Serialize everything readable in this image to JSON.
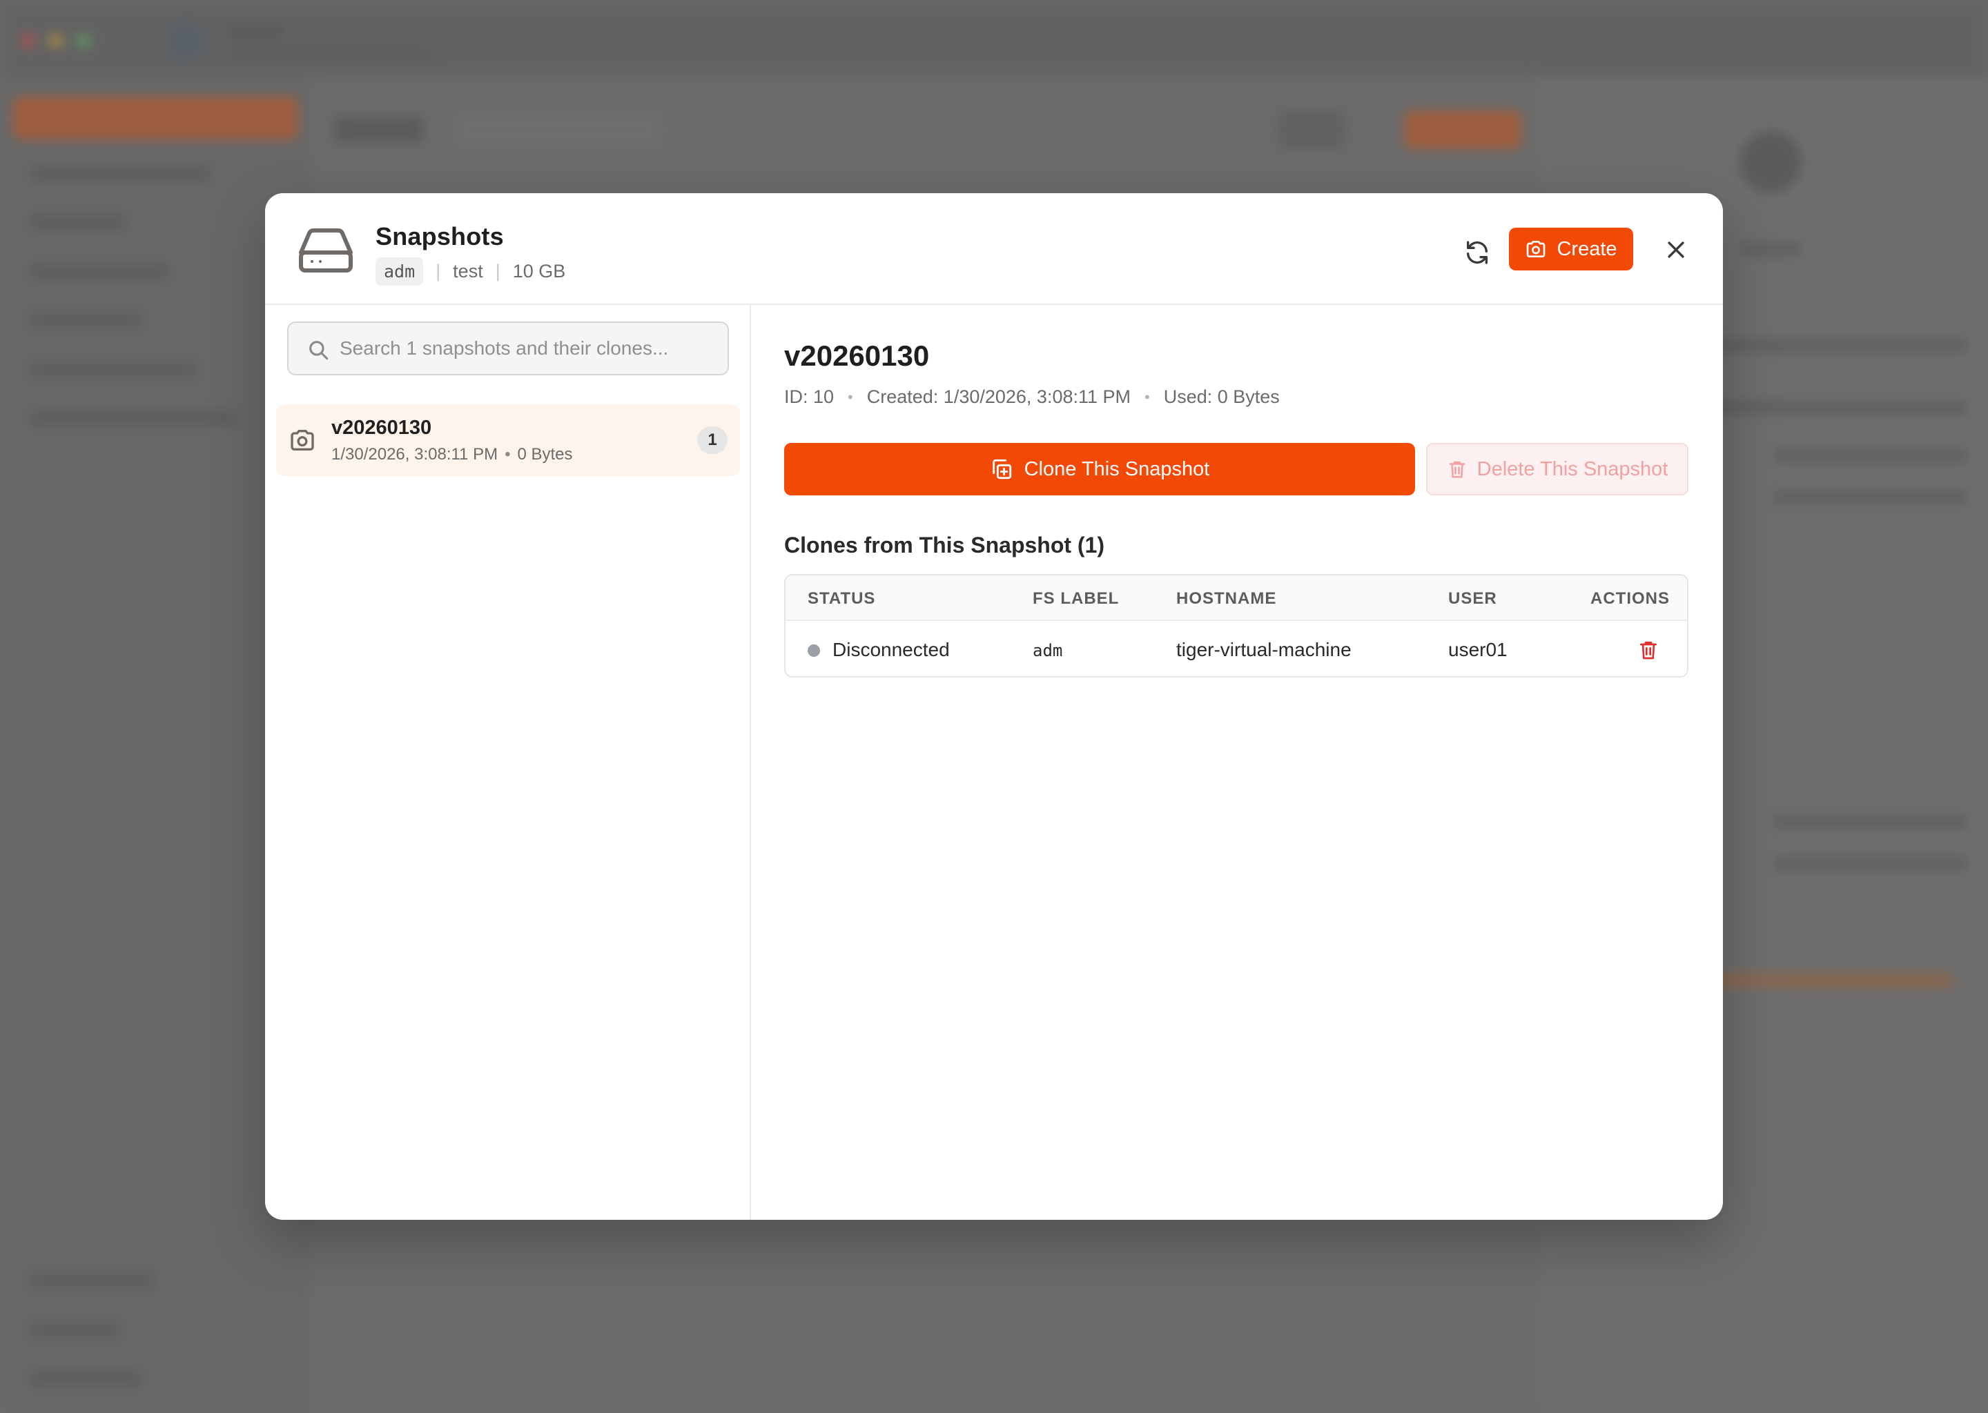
{
  "colors": {
    "accent": "#f24a06",
    "danger": "#e0302e",
    "status_disconnected": "#9aa0a8"
  },
  "modal": {
    "title": "Snapshots",
    "meta": {
      "chip": "adm",
      "name": "test",
      "size": "10 GB"
    },
    "actions": {
      "create_label": "Create"
    },
    "icons": {
      "header": "hard-drive-icon",
      "refresh": "refresh-icon",
      "create": "camera-icon",
      "close": "close-icon"
    }
  },
  "search": {
    "placeholder": "Search 1 snapshots and their clones..."
  },
  "snapshots": [
    {
      "name": "v20260130",
      "date": "1/30/2026, 3:08:11 PM",
      "dot": "•",
      "size": "0 Bytes",
      "count": "1"
    }
  ],
  "detail": {
    "title": "v20260130",
    "meta": {
      "id": "ID: 10",
      "created": "Created: 1/30/2026, 3:08:11 PM",
      "used": "Used: 0 Bytes",
      "sep": "•"
    },
    "clone_label": "Clone This Snapshot",
    "delete_label": "Delete This Snapshot",
    "clones_heading": "Clones from This Snapshot (1)",
    "table": {
      "headers": {
        "status": "STATUS",
        "fs_label": "FS LABEL",
        "hostname": "HOSTNAME",
        "user": "USER",
        "actions": "ACTIONS"
      },
      "rows": [
        {
          "status": "Disconnected",
          "fs_label": "adm",
          "hostname": "tiger-virtual-machine",
          "user": "user01"
        }
      ]
    }
  }
}
